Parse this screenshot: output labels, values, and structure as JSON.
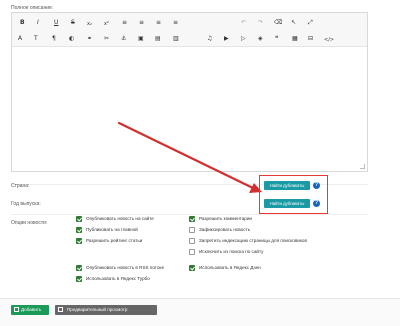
{
  "form": {
    "full_description_label": "Полное описание:",
    "country_label": "Страна:",
    "year_label": "Год выпуска:",
    "options_label": "Опции новости:",
    "find_duplicates_label": "Найти дубликаты",
    "help_glyph": "?"
  },
  "toolbar": {
    "row1": [
      {
        "icon": "bold-icon",
        "glyph": "B"
      },
      {
        "icon": "italic-icon",
        "glyph": "I"
      },
      {
        "icon": "underline-icon",
        "glyph": "U"
      },
      {
        "icon": "strikethrough-icon",
        "glyph": "S"
      },
      {
        "icon": "subscript-icon",
        "glyph": "x₂"
      },
      {
        "icon": "superscript-icon",
        "glyph": "x²"
      },
      {
        "icon": "align-left-icon",
        "glyph": "≡"
      },
      {
        "icon": "align-center-icon",
        "glyph": "≡"
      },
      {
        "icon": "align-right-icon",
        "glyph": "≡"
      },
      {
        "icon": "align-justify-icon",
        "glyph": "≡"
      },
      {
        "icon": "undo-icon",
        "glyph": "↶"
      },
      {
        "icon": "redo-icon",
        "glyph": "↷"
      },
      {
        "icon": "clear-format-icon",
        "glyph": "⌫"
      },
      {
        "icon": "pointer-icon",
        "glyph": "↖"
      },
      {
        "icon": "fullscreen-icon",
        "glyph": "⤢"
      }
    ],
    "row2": [
      {
        "icon": "font-icon",
        "glyph": "A"
      },
      {
        "icon": "font-size-icon",
        "glyph": "T"
      },
      {
        "icon": "paragraph-icon",
        "glyph": "¶"
      },
      {
        "icon": "color-icon",
        "glyph": "◐"
      },
      {
        "icon": "link-icon",
        "glyph": "⚭"
      },
      {
        "icon": "unlink-icon",
        "glyph": "✂"
      },
      {
        "icon": "anchor-icon",
        "glyph": "⚓"
      },
      {
        "icon": "image-icon",
        "glyph": "▣"
      },
      {
        "icon": "gallery-icon",
        "glyph": "▤"
      },
      {
        "icon": "file-icon",
        "glyph": "▥"
      },
      {
        "icon": "music-icon",
        "glyph": "♫"
      },
      {
        "icon": "video-icon",
        "glyph": "▶"
      },
      {
        "icon": "youtube-icon",
        "glyph": "▷"
      },
      {
        "icon": "spoiler-icon",
        "glyph": "◈"
      },
      {
        "icon": "quote-icon",
        "glyph": "❝"
      },
      {
        "icon": "table-icon",
        "glyph": "▦"
      },
      {
        "icon": "page-break-icon",
        "glyph": "⊟"
      },
      {
        "icon": "code-icon",
        "glyph": "</>"
      }
    ]
  },
  "options": {
    "left": [
      {
        "label": "Опубликовать новость на сайте",
        "checked": true
      },
      {
        "label": "Публиковать на главной",
        "checked": true
      },
      {
        "label": "Разрешить рейтинг статьи",
        "checked": true
      }
    ],
    "right": [
      {
        "label": "Разрешить комментарии",
        "checked": true
      },
      {
        "label": "Зафиксировать новость",
        "checked": false
      },
      {
        "label": "Запретить индексацию страницы для поисковиков",
        "checked": false
      },
      {
        "label": "Исключить из поиска по сайту",
        "checked": false
      }
    ],
    "bottom_left": [
      {
        "label": "Опубликовать новость в RSS потоке",
        "checked": true
      },
      {
        "label": "Использовать в Яндекс Турбо",
        "checked": true
      }
    ],
    "bottom_right": [
      {
        "label": "Использовать в Яндекс Дзен",
        "checked": true
      }
    ]
  },
  "footer": {
    "add_label": "Добавить",
    "preview_label": "Предварительный просмотр"
  },
  "colors": {
    "find_button": "#1a9aa5",
    "help": "#1565c0",
    "highlight": "#e53935",
    "add_button": "#1b9a59",
    "preview_button": "#666666",
    "checkbox_checked": "#2e7d32"
  }
}
